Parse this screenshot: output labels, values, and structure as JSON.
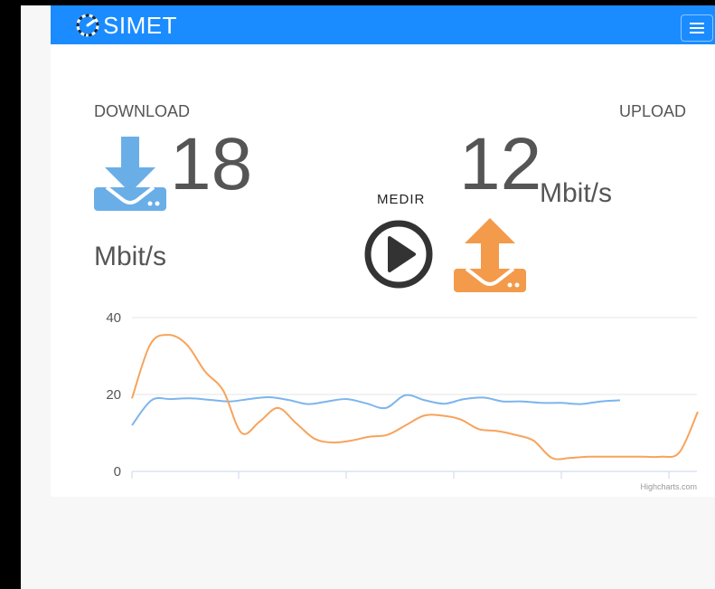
{
  "app": {
    "logo_text": "SIMET"
  },
  "download": {
    "label": "DOWNLOAD",
    "value": "18",
    "unit": "Mbit/s"
  },
  "upload": {
    "label": "UPLOAD",
    "value": "12",
    "unit": "Mbit/s"
  },
  "measure": {
    "label": "MEDIR"
  },
  "colors": {
    "brand": "#1a8cff",
    "download": "#7cb5ec",
    "upload": "#f7a35c"
  },
  "chart_data": {
    "type": "line",
    "yticks": [
      "0",
      "20",
      "40"
    ],
    "ylim": [
      0,
      40
    ],
    "grid": true,
    "credit": "Highcharts.com",
    "series": [
      {
        "x": [
          0,
          1,
          2,
          3,
          4,
          5,
          6,
          7,
          8,
          9,
          10,
          11,
          12,
          13,
          14,
          15,
          16,
          17,
          18,
          19,
          20,
          21,
          22,
          23,
          24,
          25
        ],
        "values": [
          12,
          18.5,
          18.8,
          19,
          18.6,
          18.2,
          18.8,
          19.3,
          18.6,
          17.5,
          18.2,
          18.8,
          17.7,
          16.5,
          19.8,
          18.5,
          17.6,
          18.8,
          19.2,
          18.2,
          18.2,
          17.8,
          17.8,
          17.5,
          18.2,
          18.5
        ]
      },
      {
        "x": [
          0,
          1,
          2,
          3,
          4,
          5,
          6,
          7,
          8,
          9,
          10,
          11,
          12,
          13,
          14,
          15,
          16,
          17,
          18,
          19,
          20,
          21,
          22,
          23,
          24,
          25,
          26,
          27,
          28,
          29,
          30,
          31
        ],
        "values": [
          19,
          33,
          35.5,
          33,
          26,
          21,
          10,
          13,
          16.5,
          12.5,
          8.5,
          7.5,
          8,
          9,
          9.5,
          12,
          14.5,
          14.5,
          13.5,
          11,
          10.5,
          9.5,
          8,
          3.5,
          3.5,
          3.8,
          3.8,
          3.8,
          3.8,
          3.8,
          5,
          15.5
        ]
      }
    ]
  }
}
